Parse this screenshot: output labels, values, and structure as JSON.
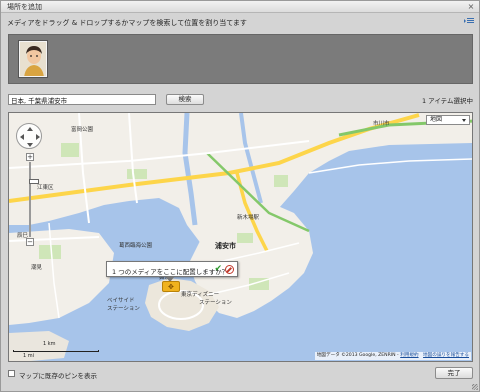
{
  "window": {
    "title": "場所を追加"
  },
  "instruction": "メディアをドラッグ & ドロップするかマップを検索して位置を割り当てます",
  "search": {
    "value": "日本, 千葉県浦安市",
    "button_label": "検索"
  },
  "item_count": "1 アイテム選択中",
  "map": {
    "type_select": "地図",
    "popup_text": "1 つのメディアをここに配置しますか？",
    "scale_km": "1 km",
    "scale_mi": "1 mi",
    "attribution": "地図データ ©2013 Google, ZENRIN -",
    "attribution_link": "利用規約",
    "report_link": "地図の誤りを報告する",
    "labels": {
      "urayasu": "浦安市",
      "station1": "ベイサイド",
      "station1b": "ステーション",
      "station2": "東京ディズニー",
      "station2b": "ステーション",
      "shinkiba": "新木場駅",
      "tomioka": "富岡公園",
      "ichikawa": "市川市",
      "koto": "江東区",
      "kasai": "葛西臨海公園",
      "tatsumi": "辰巳",
      "shiohama": "潮見",
      "maihama": "舞浜"
    }
  },
  "footer": {
    "checkbox_label": "マップに既存のピンを表示",
    "done_label": "完了"
  },
  "colors": {
    "water": "#a7c4ea",
    "land": "#f2efe9",
    "park": "#cfe6b8",
    "highway": "#fdd54a",
    "main_road": "#ffffff",
    "green_road": "#84c86a",
    "pin": "#f0b21e"
  }
}
